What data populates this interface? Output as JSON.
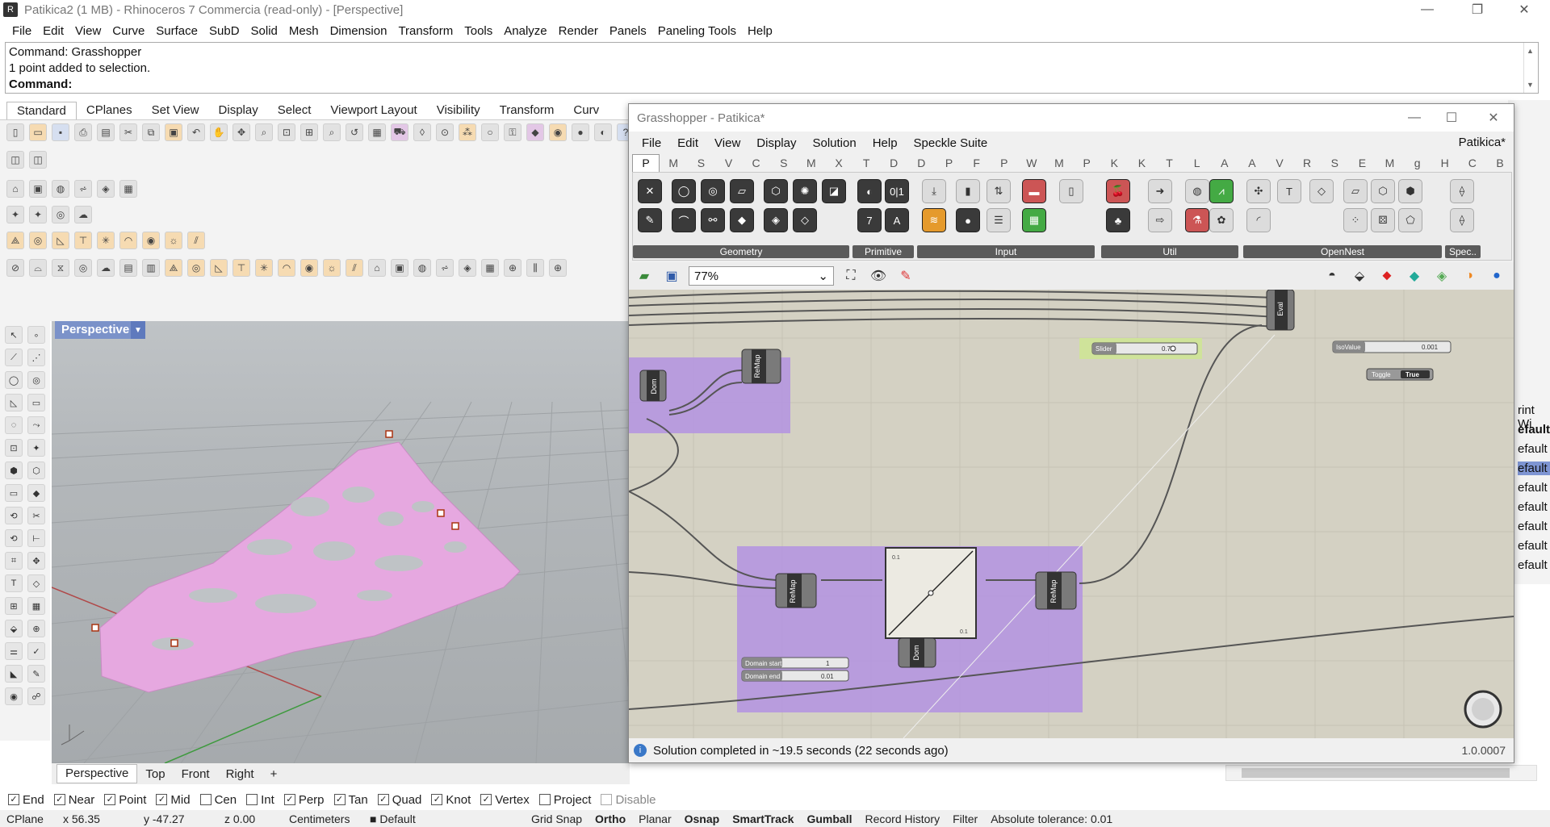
{
  "window": {
    "title": "Patikica2 (1 MB) - Rhinoceros 7 Commercia (read-only) - [Perspective]",
    "controls": [
      "—",
      "❐",
      "✕"
    ]
  },
  "menu": [
    "File",
    "Edit",
    "View",
    "Curve",
    "Surface",
    "SubD",
    "Solid",
    "Mesh",
    "Dimension",
    "Transform",
    "Tools",
    "Analyze",
    "Render",
    "Panels",
    "Paneling Tools",
    "Help"
  ],
  "command": {
    "history": [
      "Command: Grasshopper",
      "1 point added to selection."
    ],
    "prompt": "Command:"
  },
  "toolbar_tabs": [
    "Standard",
    "CPlanes",
    "Set View",
    "Display",
    "Select",
    "Viewport Layout",
    "Visibility",
    "Transform",
    "Curv"
  ],
  "viewport": {
    "label": "Perspective",
    "tabs": [
      "Perspective",
      "Top",
      "Front",
      "Right"
    ],
    "add_tab": "+"
  },
  "osnap": [
    {
      "label": "End",
      "checked": true
    },
    {
      "label": "Near",
      "checked": true
    },
    {
      "label": "Point",
      "checked": true
    },
    {
      "label": "Mid",
      "checked": true
    },
    {
      "label": "Cen",
      "checked": false
    },
    {
      "label": "Int",
      "checked": false
    },
    {
      "label": "Perp",
      "checked": true
    },
    {
      "label": "Tan",
      "checked": true
    },
    {
      "label": "Quad",
      "checked": true
    },
    {
      "label": "Knot",
      "checked": true
    },
    {
      "label": "Vertex",
      "checked": true
    },
    {
      "label": "Project",
      "checked": false
    },
    {
      "label": "Disable",
      "checked": false
    }
  ],
  "status": {
    "cplane": "CPlane",
    "x": "x 56.35",
    "y": "y -47.27",
    "z": "z 0.00",
    "units": "Centimeters",
    "layer": "Default",
    "grid_snap": "Grid Snap",
    "ortho": "Ortho",
    "planar": "Planar",
    "osnap": "Osnap",
    "smarttrack": "SmartTrack",
    "gumball": "Gumball",
    "record_history": "Record History",
    "filter": "Filter",
    "tolerance": "Absolute tolerance: 0.01"
  },
  "right_dock": {
    "items": [
      "rint Wi",
      "efault",
      "efault",
      "efault",
      "efault",
      "efault",
      "efault",
      "efault",
      "efault"
    ],
    "selected_index": 3,
    "bold_index": 1
  },
  "grasshopper": {
    "title": "Grasshopper - Patikica*",
    "menu": [
      "File",
      "Edit",
      "View",
      "Display",
      "Solution",
      "Help",
      "Speckle Suite"
    ],
    "doc_name": "Patikica*",
    "tabs": [
      "P",
      "M",
      "S",
      "V",
      "C",
      "S",
      "M",
      "X",
      "T",
      "D",
      "D",
      "P",
      "F",
      "P",
      "W",
      "M",
      "P",
      "K",
      "K",
      "T",
      "L",
      "A",
      "A",
      "V",
      "R",
      "S",
      "E",
      "M",
      "g",
      "H",
      "C",
      "B"
    ],
    "groups": [
      "Geometry",
      "Primitive",
      "Input",
      "Util",
      "OpenNest",
      "Spec.."
    ],
    "zoom": "77%",
    "status": "Solution completed in ~19.5 seconds (22 seconds ago)",
    "version": "1.0.0007",
    "canvas": {
      "components": {
        "dom": "Dom",
        "remap": "ReMap",
        "eval": "Eval"
      },
      "slider": {
        "label": "Slider",
        "value": "0.7"
      },
      "isovalue": {
        "label": "IsoValue",
        "value": "0.001"
      },
      "toggle": {
        "label": "Toggle",
        "value": "True"
      },
      "domain_start": {
        "label": "Domain start",
        "value": "1"
      },
      "domain_end": {
        "label": "Domain end",
        "value": "0.01"
      },
      "graph_labels": [
        "0.1",
        "0.1"
      ]
    }
  }
}
